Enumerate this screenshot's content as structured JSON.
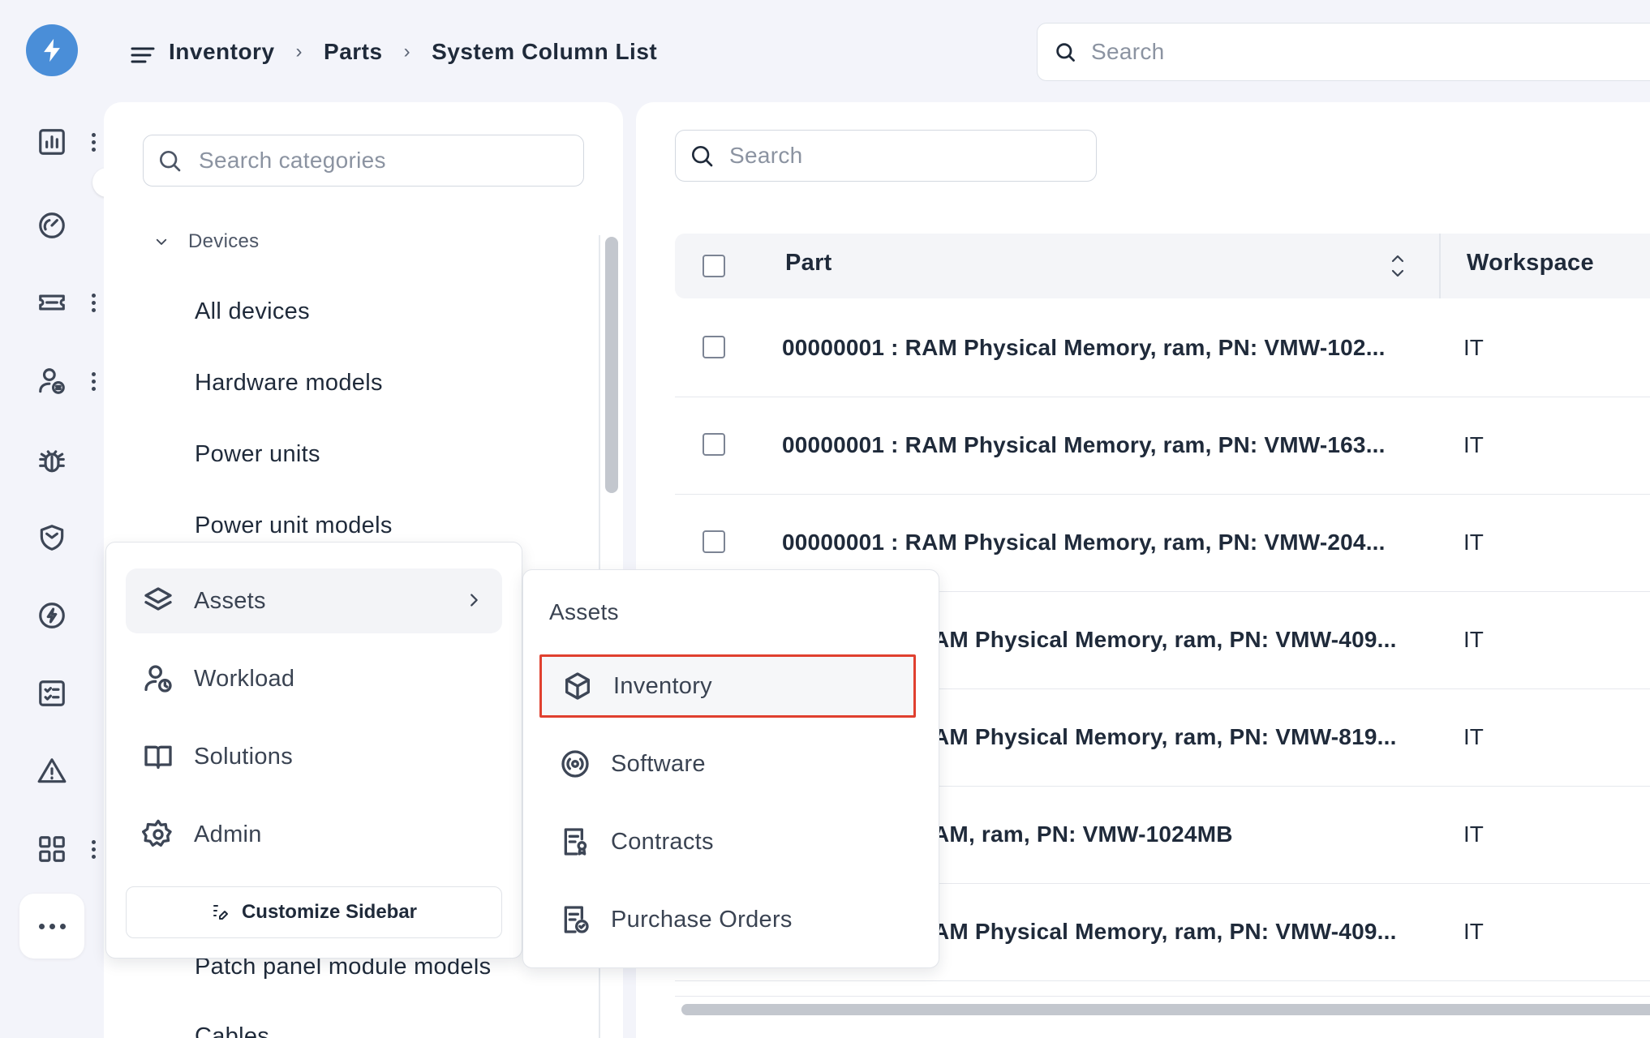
{
  "breadcrumb": [
    "Inventory",
    "Parts",
    "System Column List"
  ],
  "top_search": {
    "placeholder": "Search"
  },
  "categories": {
    "search_placeholder": "Search categories",
    "group": "Devices",
    "items": [
      "All devices",
      "Hardware models",
      "Power units",
      "Power unit models",
      "Patch panel module models",
      "Cables"
    ]
  },
  "table": {
    "search_placeholder": "Search",
    "columns": [
      "Part",
      "Workspace"
    ],
    "rows": [
      {
        "part": "00000001 : RAM Physical Memory, ram, PN: VMW-102...",
        "workspace": "IT"
      },
      {
        "part": "00000001 : RAM Physical Memory, ram, PN: VMW-163...",
        "workspace": "IT"
      },
      {
        "part": "00000001 : RAM Physical Memory, ram, PN: VMW-204...",
        "workspace": "IT"
      },
      {
        "part": "AM Physical Memory, ram, PN: VMW-409...",
        "workspace": "IT"
      },
      {
        "part": "AM Physical Memory, ram, PN: VMW-819...",
        "workspace": "IT"
      },
      {
        "part": "AM, ram, PN: VMW-1024MB",
        "workspace": "IT"
      },
      {
        "part": "AM Physical Memory, ram, PN: VMW-409...",
        "workspace": "IT"
      }
    ]
  },
  "menu": {
    "items": [
      {
        "label": "Assets",
        "icon": "layers-icon"
      },
      {
        "label": "Workload",
        "icon": "user-clock-icon"
      },
      {
        "label": "Solutions",
        "icon": "book-icon"
      },
      {
        "label": "Admin",
        "icon": "gear-icon"
      }
    ],
    "customize_label": "Customize Sidebar"
  },
  "submenu": {
    "title": "Assets",
    "items": [
      {
        "label": "Inventory",
        "icon": "box-icon"
      },
      {
        "label": "Software",
        "icon": "disc-icon"
      },
      {
        "label": "Contracts",
        "icon": "contract-icon"
      },
      {
        "label": "Purchase Orders",
        "icon": "purchase-order-icon"
      }
    ]
  },
  "rail_icons": [
    "chart-icon",
    "gauge-icon",
    "ticket-icon",
    "user-change-icon",
    "bug-icon",
    "shield-icon",
    "bolt-circle-icon",
    "checklist-icon",
    "warning-icon",
    "apps-icon"
  ],
  "colors": {
    "brand": "#4a8ed8",
    "selection_border": "#e0402f",
    "background": "#f3f4fa"
  }
}
